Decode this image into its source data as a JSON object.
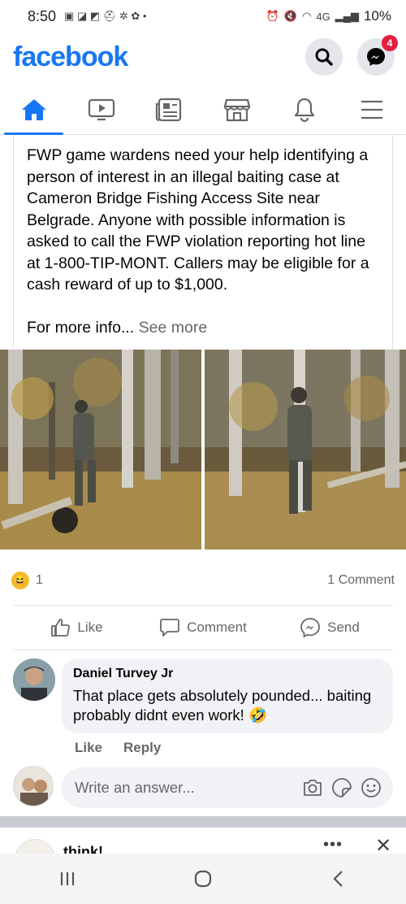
{
  "status_bar": {
    "time": "8:50",
    "network": "4G",
    "battery": "10%"
  },
  "header": {
    "logo": "facebook",
    "messenger_badge": "4"
  },
  "nav": {
    "tabs": [
      "home",
      "watch",
      "news",
      "marketplace",
      "notifications",
      "menu"
    ],
    "active": "home"
  },
  "post": {
    "text": "FWP game wardens need your help identifying a person of interest in an illegal baiting case at Cameron Bridge Fishing Access Site near Belgrade. Anyone with possible information is asked to call the FWP violation reporting hot line at 1-800-TIP-MONT. Callers may be eligible for a cash reward of up to $1,000.",
    "more_text": "For more info...",
    "see_more": "See more",
    "reaction_count": "1",
    "comment_count": "1 Comment",
    "actions": {
      "like": "Like",
      "comment": "Comment",
      "send": "Send"
    }
  },
  "comment": {
    "author": "Daniel Turvey Jr",
    "text": "That place gets absolutely pounded... baiting probably didnt even work! 🤣",
    "like": "Like",
    "reply": "Reply"
  },
  "reply_box": {
    "placeholder": "Write an answer..."
  },
  "next_post": {
    "title": "think!",
    "more": "•••",
    "close": "✕"
  },
  "colors": {
    "brand": "#1877f2",
    "badge": "#e41e3f",
    "muted": "#65676b",
    "bubble": "#f0f2f5"
  }
}
